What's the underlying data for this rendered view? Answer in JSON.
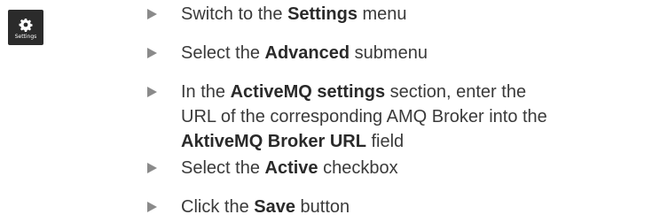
{
  "settings_tile": {
    "label": "Settings",
    "icon": "gear-icon"
  },
  "steps": [
    {
      "parts": [
        {
          "t": "Switch to the ",
          "b": false
        },
        {
          "t": "Settings",
          "b": true
        },
        {
          "t": " menu",
          "b": false
        }
      ]
    },
    {
      "parts": [
        {
          "t": "Select the ",
          "b": false
        },
        {
          "t": "Advanced",
          "b": true
        },
        {
          "t": " submenu",
          "b": false
        }
      ]
    },
    {
      "lines": [
        [
          {
            "t": "In the ",
            "b": false
          },
          {
            "t": "ActiveMQ settings",
            "b": true
          },
          {
            "t": " section, enter the",
            "b": false
          }
        ],
        [
          {
            "t": "URL of the corresponding AMQ Broker into the",
            "b": false
          }
        ],
        [
          {
            "t": "AktiveMQ Broker URL",
            "b": true
          },
          {
            "t": " field",
            "b": false
          }
        ]
      ]
    },
    {
      "parts": [
        {
          "t": "Select the ",
          "b": false
        },
        {
          "t": "Active",
          "b": true
        },
        {
          "t": " checkbox",
          "b": false
        }
      ]
    },
    {
      "parts": [
        {
          "t": "Click the ",
          "b": false
        },
        {
          "t": "Save",
          "b": true
        },
        {
          "t": " button",
          "b": false
        }
      ]
    }
  ],
  "colors": {
    "tile_background": "#2b2b2b",
    "arrow": "#8a8a8a",
    "text": "#3a3a3a"
  }
}
